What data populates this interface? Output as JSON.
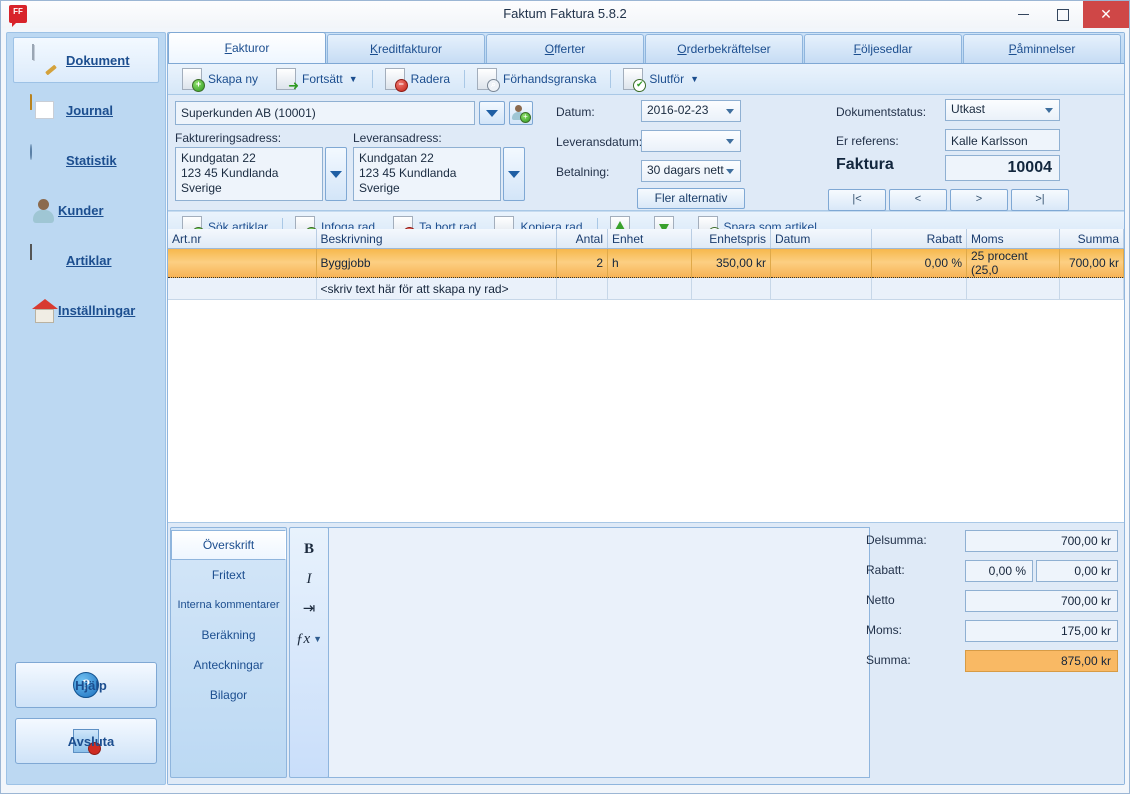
{
  "window": {
    "title": "Faktum Faktura 5.8.2",
    "app_icon": "FF",
    "minimize": "—",
    "maximize": "▢",
    "close": "✕"
  },
  "sidebar": {
    "items": [
      {
        "label": "Dokument",
        "icon": "document-icon",
        "active": true
      },
      {
        "label": "Journal",
        "icon": "folder-icon",
        "active": false
      },
      {
        "label": "Statistik",
        "icon": "pie-chart-icon",
        "active": false
      },
      {
        "label": "Kunder",
        "icon": "user-icon",
        "active": false
      },
      {
        "label": "Artiklar",
        "icon": "barcode-icon",
        "active": false
      },
      {
        "label": "Inställningar",
        "icon": "house-gear-icon",
        "active": false
      }
    ],
    "help_button": "Hjälp",
    "exit_button": "Avsluta"
  },
  "tabs": [
    {
      "label": "Fakturor",
      "active": true
    },
    {
      "label": "Kreditfakturor",
      "active": false
    },
    {
      "label": "Offerter",
      "active": false
    },
    {
      "label": "Orderbekräftelser",
      "active": false
    },
    {
      "label": "Följesedlar",
      "active": false
    },
    {
      "label": "Påminnelser",
      "active": false
    }
  ],
  "doc_toolbar": [
    {
      "label": "Skapa ny",
      "icon": "new-document-icon",
      "dropdown": false
    },
    {
      "label": "Fortsätt",
      "icon": "continue-document-icon",
      "dropdown": true
    },
    {
      "label": "Radera",
      "icon": "delete-document-icon",
      "dropdown": false
    },
    {
      "label": "Förhandsgranska",
      "icon": "preview-document-icon",
      "dropdown": false
    },
    {
      "label": "Slutför",
      "icon": "finish-document-icon",
      "dropdown": true
    }
  ],
  "row_toolbar": [
    {
      "label": "Sök artiklar",
      "icon": "search-article-icon"
    },
    {
      "label": "Infoga rad",
      "icon": "insert-row-icon"
    },
    {
      "label": "Ta bort rad",
      "icon": "delete-row-icon"
    },
    {
      "label": "Kopiera rad",
      "icon": "copy-row-icon"
    },
    {
      "label": "",
      "icon": "move-row-up-icon"
    },
    {
      "label": "",
      "icon": "move-row-down-icon"
    },
    {
      "label": "Spara som artikel",
      "icon": "save-as-article-icon"
    }
  ],
  "form": {
    "customer": "Superkunden AB (10001)",
    "billing_label": "Faktureringsadress:",
    "billing_address": "Kundgatan 22\n123 45 Kundlanda\nSverige",
    "delivery_label": "Leveransadress:",
    "delivery_address": "Kundgatan 22\n123 45 Kundlanda\nSverige",
    "date_label": "Datum:",
    "date_value": "2016-02-23",
    "delivery_date_label": "Leveransdatum:",
    "delivery_date_value": "",
    "payment_label": "Betalning:",
    "payment_value": "30 dagars nett",
    "more_options": "Fler alternativ",
    "status_label": "Dokumentstatus:",
    "status_value": "Utkast",
    "reference_label": "Er referens:",
    "reference_value": "Kalle Karlsson",
    "doc_type": "Faktura",
    "doc_number": "10004",
    "nav": [
      "|<",
      "<",
      ">",
      ">|"
    ]
  },
  "grid": {
    "columns": [
      "Art.nr",
      "Beskrivning",
      "Antal",
      "Enhet",
      "Enhetspris",
      "Datum",
      "Rabatt",
      "Moms",
      "Summa"
    ],
    "rows": [
      {
        "artnr": "",
        "beskrivning": "Byggjobb",
        "antal": "2",
        "enhet": "h",
        "enhetspris": "350,00 kr",
        "datum": "",
        "rabatt": "0,00 %",
        "moms": "25 procent (25,0",
        "summa": "700,00 kr",
        "selected": true
      }
    ],
    "new_row_placeholder": "<skriv text här för att skapa ny rad>"
  },
  "editor": {
    "tabs": [
      {
        "label": "Överskrift",
        "active": true
      },
      {
        "label": "Fritext",
        "active": false
      },
      {
        "label": "Interna kommentarer",
        "active": false
      },
      {
        "label": "Beräkning",
        "active": false
      },
      {
        "label": "Anteckningar",
        "active": false
      },
      {
        "label": "Bilagor",
        "active": false
      }
    ],
    "tools": [
      {
        "glyph": "B",
        "name": "bold-icon"
      },
      {
        "glyph": "I",
        "name": "italic-icon"
      },
      {
        "glyph": "⇥",
        "name": "tab-stop-icon"
      },
      {
        "glyph": "ƒx",
        "name": "formula-icon"
      }
    ],
    "content": ""
  },
  "totals": {
    "subtotal_label": "Delsumma:",
    "subtotal_value": "700,00 kr",
    "discount_label": "Rabatt:",
    "discount_percent": "0,00 %",
    "discount_value": "0,00 kr",
    "net_label": "Netto",
    "net_value": "700,00 kr",
    "vat_label": "Moms:",
    "vat_value": "175,00 kr",
    "total_label": "Summa:",
    "total_value": "875,00 kr"
  },
  "colors": {
    "accent": "#1c4e8f",
    "selection": "#f9b964",
    "close_button": "#cf4747",
    "panel": "#dfeaf7"
  }
}
